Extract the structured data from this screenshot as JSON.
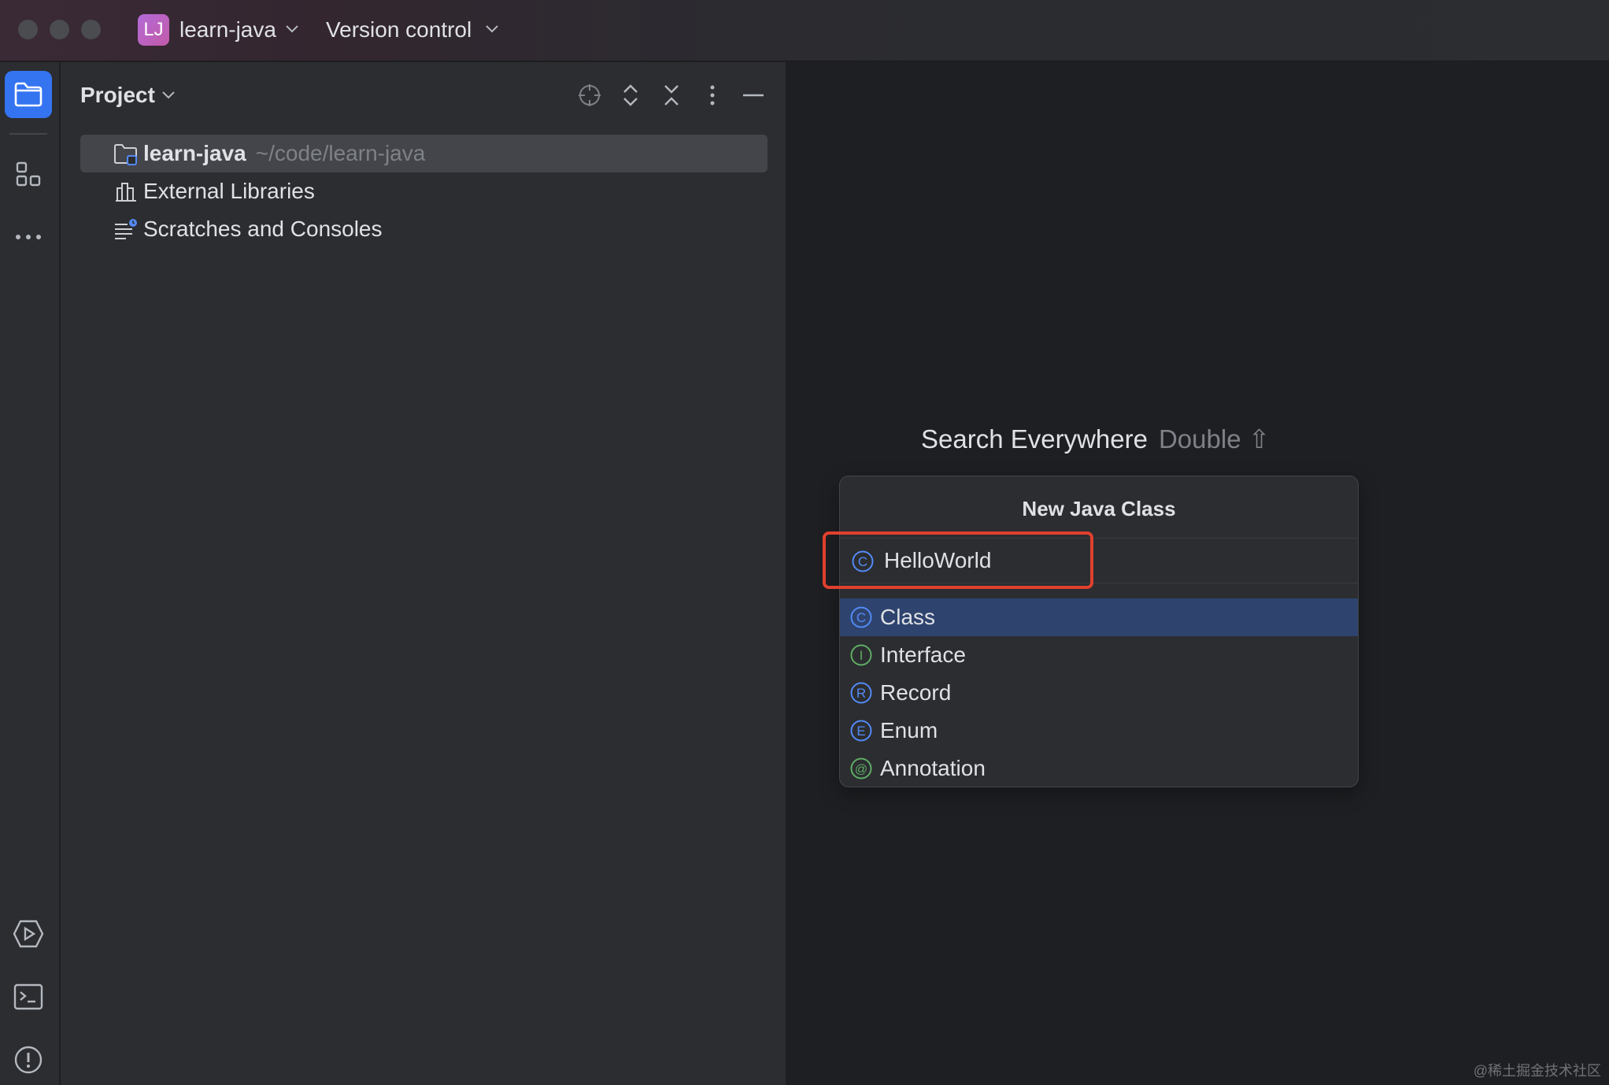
{
  "titlebar": {
    "project_avatar": "LJ",
    "project_name": "learn-java",
    "vcs_label": "Version control"
  },
  "toolstrip": {
    "top_icons": [
      "folder-icon",
      "structure-icon",
      "more-icon"
    ],
    "bottom_icons": [
      "run-icon",
      "terminal-icon",
      "problems-icon"
    ]
  },
  "project_panel": {
    "title": "Project",
    "actions": [
      "locate-icon",
      "expand-all-icon",
      "collapse-all-icon",
      "options-icon",
      "hide-icon"
    ],
    "tree": [
      {
        "label": "learn-java",
        "path": "~/code/learn-java",
        "icon": "module-folder-icon",
        "selected": true
      },
      {
        "label": "External Libraries",
        "icon": "libraries-icon"
      },
      {
        "label": "Scratches and Consoles",
        "icon": "scratches-icon"
      }
    ]
  },
  "editor": {
    "hint_text": "Search Everywhere",
    "hint_key": "Double ⇧"
  },
  "popup": {
    "title": "New Java Class",
    "input_value": "HelloWorld",
    "kinds": [
      {
        "label": "Class",
        "letter": "C",
        "color": "#548af7",
        "selected": true
      },
      {
        "label": "Interface",
        "letter": "I",
        "color": "#5fad65"
      },
      {
        "label": "Record",
        "letter": "R",
        "color": "#548af7"
      },
      {
        "label": "Enum",
        "letter": "E",
        "color": "#548af7"
      },
      {
        "label": "Annotation",
        "letter": "@",
        "color": "#5fad65"
      }
    ]
  },
  "colors": {
    "accent": "#3574f0",
    "selection": "#2e436e",
    "highlight": "#e0402e"
  },
  "watermark": "@稀土掘金技术社区"
}
